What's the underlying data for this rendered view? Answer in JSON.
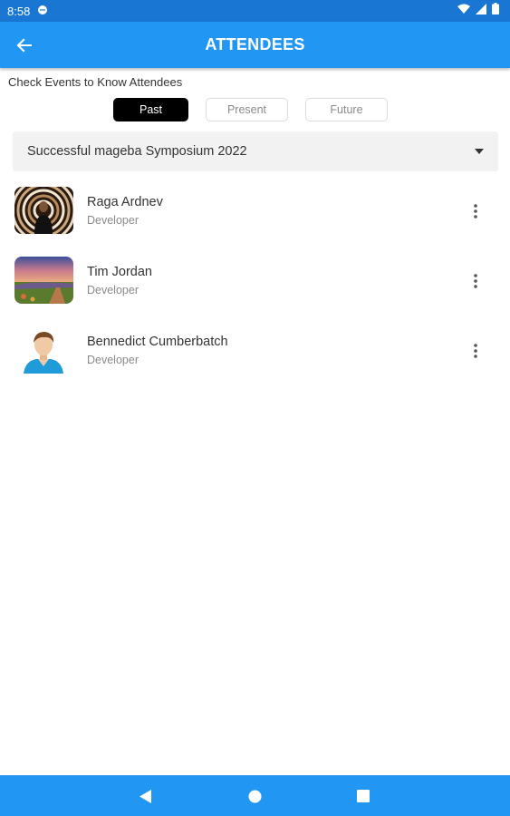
{
  "status_bar": {
    "time": "8:58"
  },
  "app_bar": {
    "title": "ATTENDEES",
    "back_icon": "arrow-left-icon"
  },
  "hint": "Check Events to Know Attendees",
  "tabs": [
    {
      "label": "Past",
      "active": true
    },
    {
      "label": "Present",
      "active": false
    },
    {
      "label": "Future",
      "active": false
    }
  ],
  "event_select": {
    "value": "Successful mageba Symposium 2022",
    "icon": "dropdown-arrow-icon"
  },
  "attendees": [
    {
      "name": "Raga Ardnev",
      "role": "Developer",
      "avatar": "spiral-photo"
    },
    {
      "name": "Tim Jordan",
      "role": "Developer",
      "avatar": "landscape-photo"
    },
    {
      "name": "Bennedict Cumberbatch",
      "role": "Developer",
      "avatar": "cartoon-man-avatar"
    }
  ],
  "colors": {
    "app_bar": "#2196f3",
    "status_bar": "#1976d2",
    "active_tab": "#000000"
  }
}
